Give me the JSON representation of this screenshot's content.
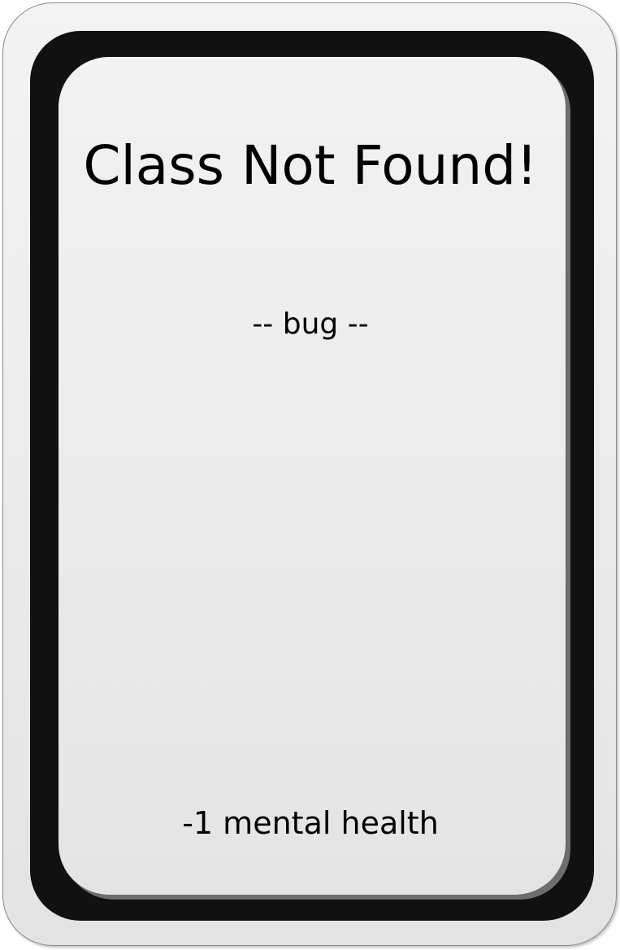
{
  "card": {
    "title": "Class Not Found!",
    "type": "-- bug --",
    "effect": "-1 mental health"
  }
}
